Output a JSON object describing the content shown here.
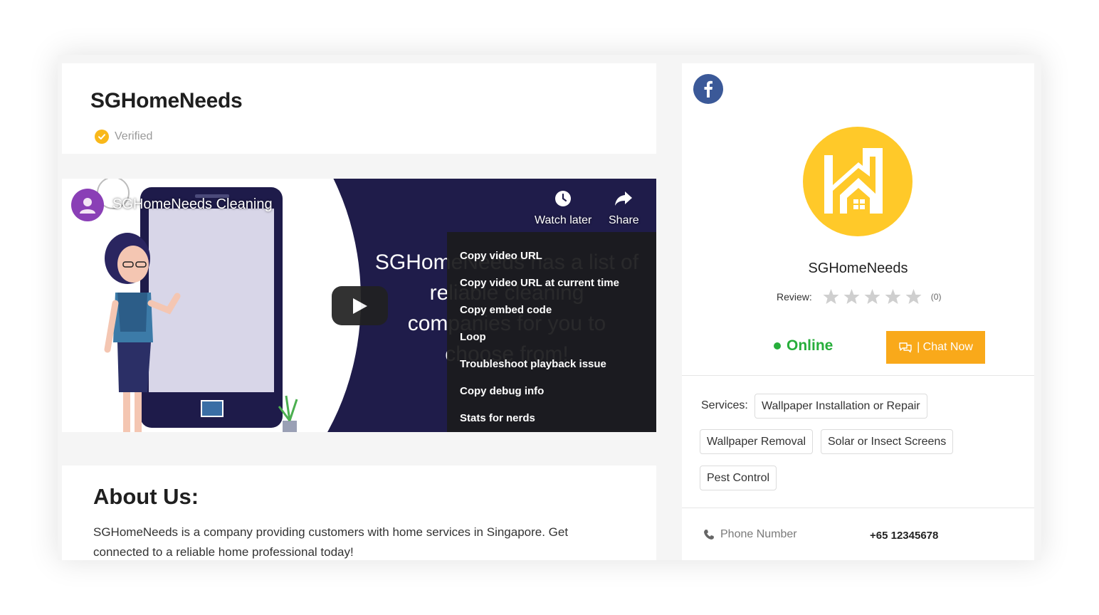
{
  "header": {
    "title": "SGHomeNeeds",
    "verified_label": "Verified"
  },
  "video": {
    "channel_title": "SGHomeNeeds Cleaning",
    "watch_later_label": "Watch later",
    "share_label": "Share",
    "overlay_lines": [
      "SGHomeNeeds has a list of",
      "reliable cleaning",
      "companies for you to",
      "choose from!"
    ],
    "context_menu": [
      "Copy video URL",
      "Copy video URL at current time",
      "Copy embed code",
      "Loop",
      "Troubleshoot playback issue",
      "Copy debug info",
      "Stats for nerds"
    ]
  },
  "about": {
    "heading": "About Us:",
    "text": "SGHomeNeeds is a company providing customers with home services in Singapore. Get connected to a reliable home professional today!"
  },
  "sidebar": {
    "business_name": "SGHomeNeeds",
    "review_label": "Review:",
    "review_count": "(0)",
    "rating": 0,
    "rating_max": 5,
    "status": "Online",
    "chat_button": "| Chat Now",
    "services_label": "Services:",
    "services": [
      "Wallpaper Installation or Repair",
      "Wallpaper Removal",
      "Solar or Insect Screens",
      "Pest Control"
    ],
    "phone_label": "Phone Number",
    "phone_value": "+65 12345678"
  },
  "colors": {
    "accent": "#f9a91a",
    "online": "#27ae3b",
    "logo": "#ffc929",
    "facebook": "#3b5998"
  }
}
